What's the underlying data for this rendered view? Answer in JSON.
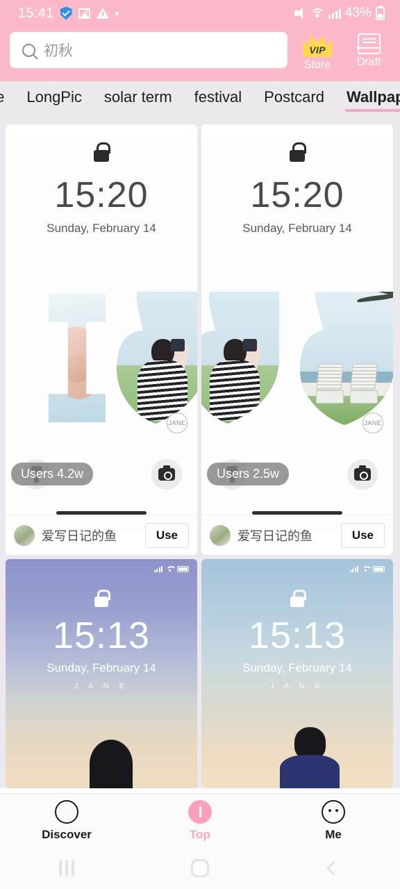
{
  "status_bar": {
    "time": "15:41",
    "battery_percent": "43%",
    "icons_left": [
      "shield-check-icon",
      "image-icon",
      "warning-icon",
      "dot-icon"
    ],
    "icons_right": [
      "mute-icon",
      "wifi-icon",
      "signal-icon",
      "battery-icon"
    ]
  },
  "header": {
    "search": {
      "value": "初秋",
      "icon": "search-icon"
    },
    "store": {
      "label": "Store",
      "badge": "VIP",
      "icon": "crown-icon"
    },
    "draft": {
      "label": "Draft",
      "icon": "tray-icon"
    },
    "background_color": "#fbb9ca"
  },
  "tabs": {
    "items": [
      {
        "label": "te",
        "active": false
      },
      {
        "label": "LongPic",
        "active": false
      },
      {
        "label": "solar term",
        "active": false
      },
      {
        "label": "festival",
        "active": false
      },
      {
        "label": "Postcard",
        "active": false
      },
      {
        "label": "Wallpaper",
        "active": true
      }
    ],
    "indicator_color": "#f7a6bd"
  },
  "wallpapers": [
    {
      "preview_style": "white",
      "time": "15:20",
      "date": "Sunday, February 14",
      "watermark": "JANE",
      "users": "Users 4.2w",
      "author": "爱写日记的鱼",
      "use_label": "Use"
    },
    {
      "preview_style": "white",
      "time": "15:20",
      "date": "Sunday, February 14",
      "watermark": "JANE",
      "users": "Users 2.5w",
      "author": "爱写日记的鱼",
      "use_label": "Use"
    },
    {
      "preview_style": "gradient-purple",
      "time": "15:13",
      "date": "Sunday, February 14",
      "watermark": "J A N E"
    },
    {
      "preview_style": "gradient-blue",
      "time": "15:13",
      "date": "Sunday, February 14",
      "watermark": "J A N E"
    }
  ],
  "bottom_nav": {
    "items": [
      {
        "label": "Discover",
        "icon": "compass-icon",
        "active": false
      },
      {
        "label": "Top",
        "icon": "top-icon",
        "active": true
      },
      {
        "label": "Me",
        "icon": "face-icon",
        "active": false
      }
    ],
    "active_color": "#f9a8c0"
  },
  "system_nav": {
    "recents": "recents-icon",
    "home": "home-icon",
    "back": "back-icon"
  }
}
